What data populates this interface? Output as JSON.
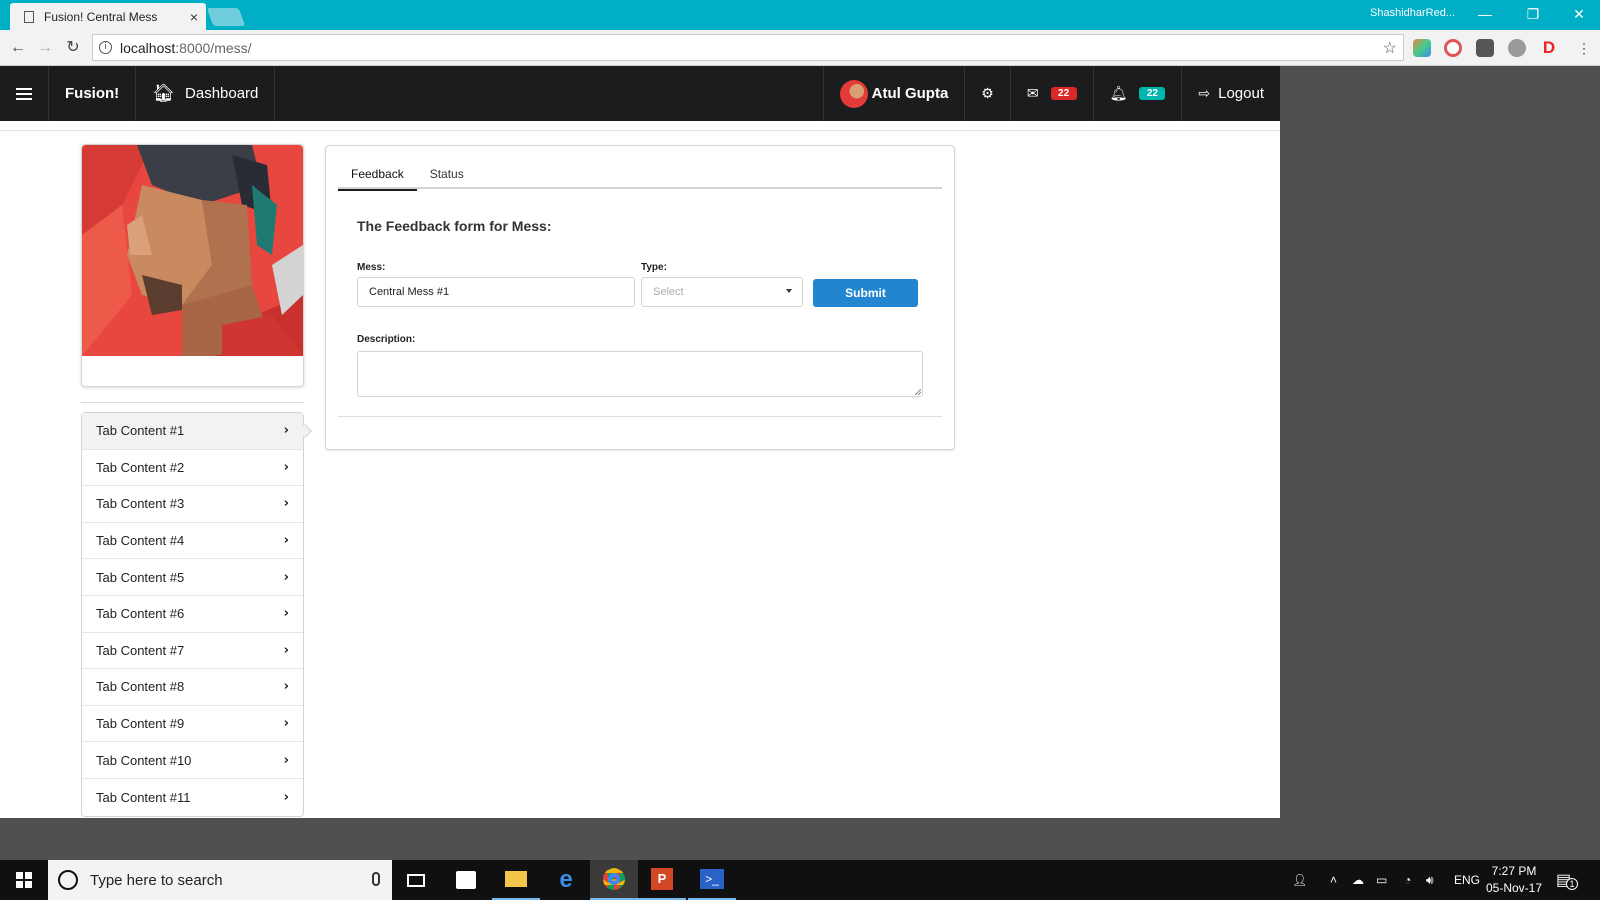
{
  "browser": {
    "tab_title": "Fusion! Central Mess",
    "tab_close": "×",
    "user_profile": "ShashidharRed...",
    "url_host": "localhost",
    "url_rest": ":8000/mess/",
    "window_controls": {
      "minimize": "—",
      "restore": "❐",
      "close": "✕"
    },
    "nav_glyphs": {
      "back": "←",
      "forward": "→",
      "reload": "↻"
    },
    "icons": [
      "info-icon",
      "bookmark-star-icon",
      "extension-icons"
    ]
  },
  "navbar": {
    "brand": "Fusion!",
    "dashboard": "Dashboard",
    "user_name": "Atul Gupta",
    "messages_count": "22",
    "notifications_count": "22",
    "logout": "Logout"
  },
  "sidebar": {
    "items": [
      {
        "label": "Tab Content #1",
        "active": true
      },
      {
        "label": "Tab Content #2"
      },
      {
        "label": "Tab Content #3"
      },
      {
        "label": "Tab Content #4"
      },
      {
        "label": "Tab Content #5"
      },
      {
        "label": "Tab Content #6"
      },
      {
        "label": "Tab Content #7"
      },
      {
        "label": "Tab Content #8"
      },
      {
        "label": "Tab Content #9"
      },
      {
        "label": "Tab Content #10"
      },
      {
        "label": "Tab Content #11"
      }
    ]
  },
  "main": {
    "tabs": [
      {
        "label": "Feedback",
        "active": true
      },
      {
        "label": "Status"
      }
    ],
    "form": {
      "title": "The Feedback form for Mess:",
      "mess_label": "Mess:",
      "mess_value": "Central Mess #1",
      "type_label": "Type:",
      "type_placeholder": "Select",
      "submit_label": "Submit",
      "description_label": "Description:"
    }
  },
  "taskbar": {
    "search_placeholder": "Type here to search",
    "language": "ENG",
    "time": "7:27 PM",
    "date": "05-Nov-17",
    "notification_count": "1"
  },
  "colors": {
    "titlebar": "#00aec6",
    "navbar": "#1b1c1d",
    "primary_button": "#2185d0",
    "badge_red": "#db2828",
    "badge_teal": "#00b5ad"
  }
}
